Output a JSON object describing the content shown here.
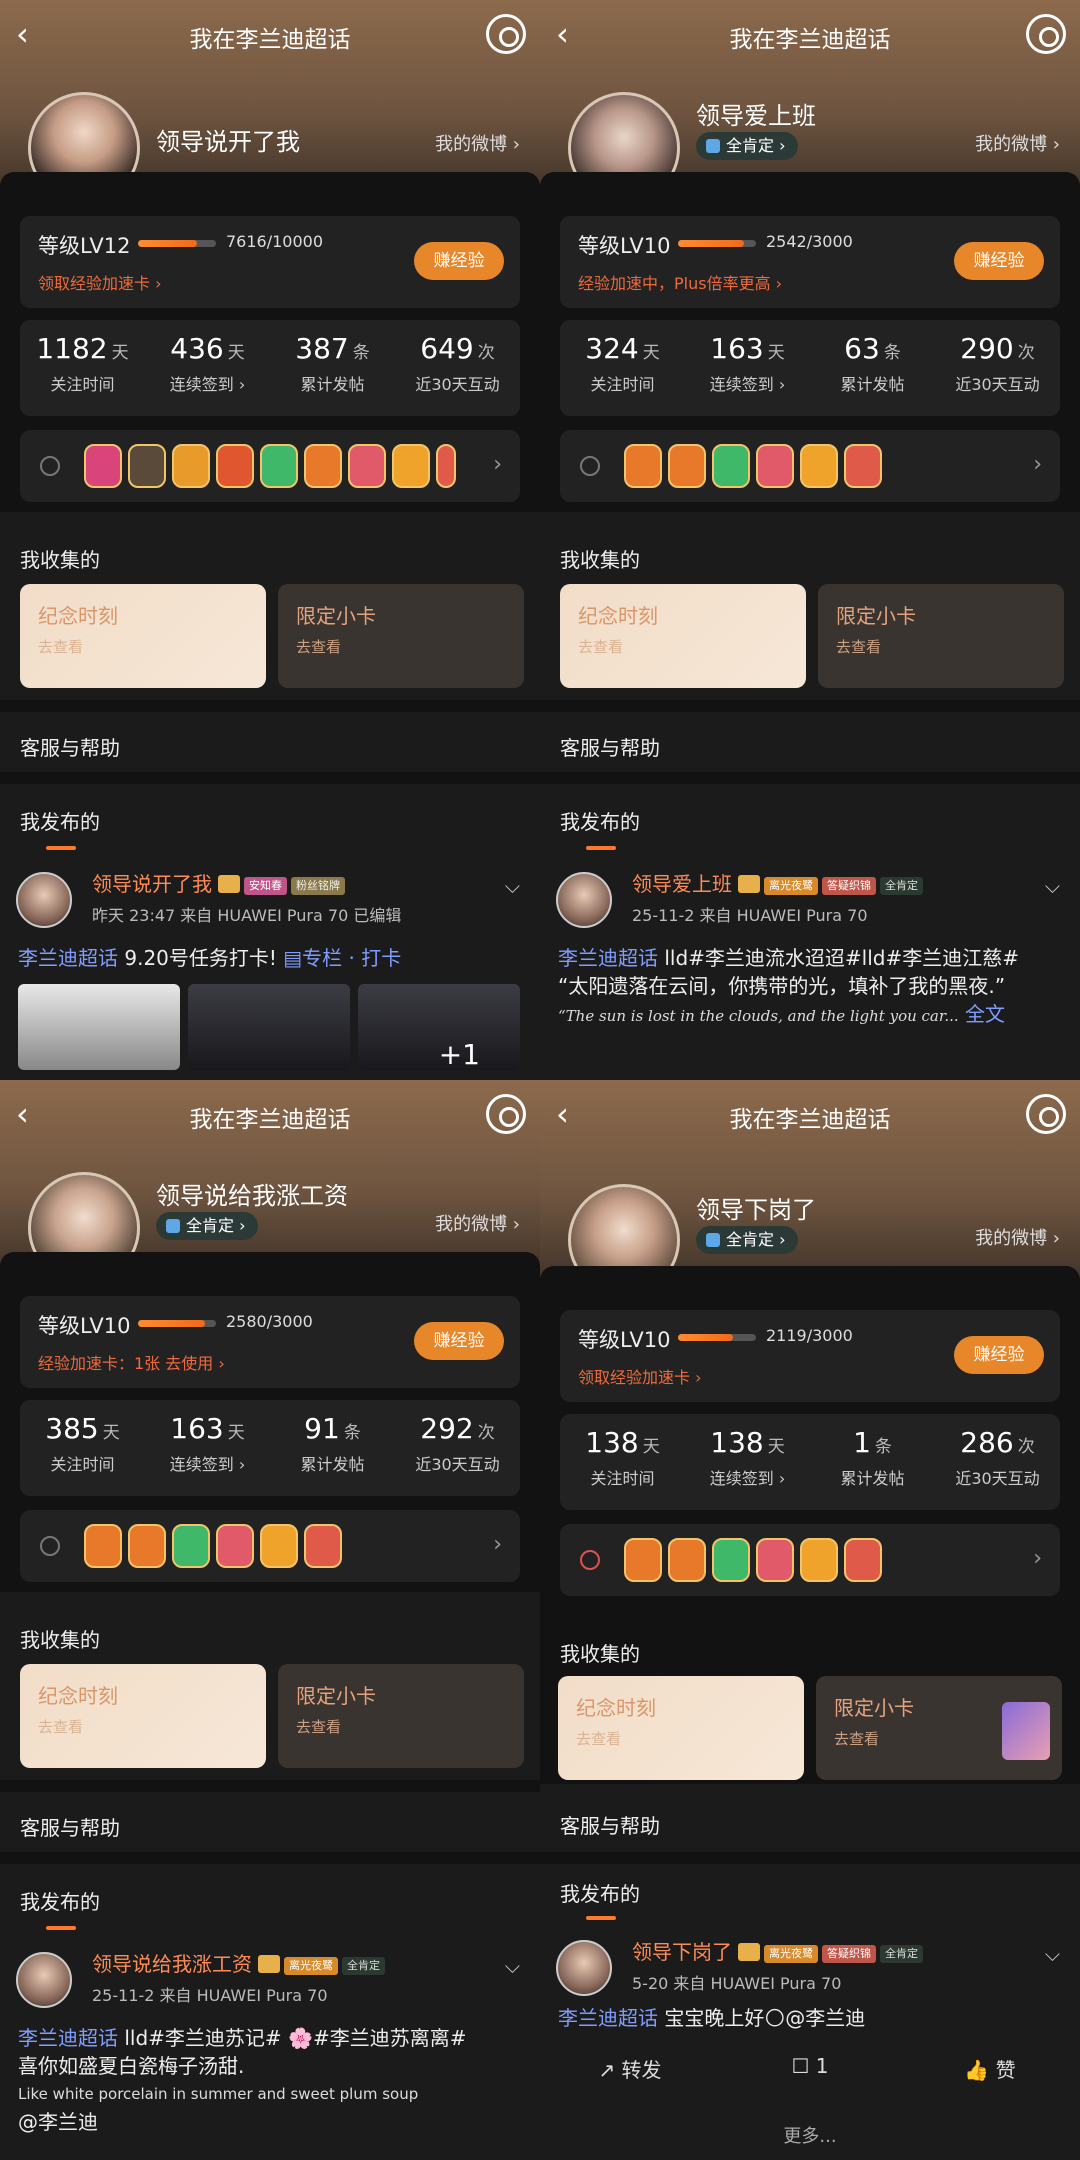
{
  "common": {
    "title": "我在李兰迪超话",
    "my_weibo": "我的微博 ›",
    "earn": "赚经验",
    "collected": "我收集的",
    "tile_a": "纪念时刻",
    "tile_b": "限定小卡",
    "tile_sub": "去查看",
    "support": "客服与帮助",
    "published": "我发布的",
    "back": "‹",
    "chev": "⌵",
    "arr": "›"
  },
  "stat_labels": [
    "关注时间",
    "连续签到 ›",
    "累计发帖",
    "近30天互动"
  ],
  "panels": [
    {
      "uname": "领导说开了我",
      "badge": "",
      "level": "等级LV12",
      "level_fraction": 0.76,
      "level_num": "7616/10000",
      "level_sub": "领取经验加速卡 ›",
      "stats": [
        {
          "v": "1182",
          "u": "天"
        },
        {
          "v": "436",
          "u": "天"
        },
        {
          "v": "387",
          "u": "条"
        },
        {
          "v": "649",
          "u": "次"
        }
      ],
      "post": {
        "name": "领导说开了我",
        "tags": [
          "安知春",
          "粉丝铭牌"
        ],
        "meta": "昨天 23:47  来自 HUAWEI Pura 70  已编辑",
        "line1_a": "李兰迪超话",
        "line1_b": " 9.20号任务打卡!  ",
        "line1_c": "▤专栏 · 打卡",
        "plus": "+1"
      }
    },
    {
      "uname": "领导爱上班",
      "badge": "全肯定 ›",
      "level": "等级LV10",
      "level_fraction": 0.85,
      "level_num": "2542/3000",
      "level_sub": "经验加速中，Plus倍率更高 ›",
      "stats": [
        {
          "v": "324",
          "u": "天"
        },
        {
          "v": "163",
          "u": "天"
        },
        {
          "v": "63",
          "u": "条"
        },
        {
          "v": "290",
          "u": "次"
        }
      ],
      "post": {
        "name": "领导爱上班",
        "tags": [
          "离光夜鹭",
          "答疑织锦",
          "全肯定"
        ],
        "meta": "25-11-2  来自 HUAWEI Pura 70",
        "line1_a": "李兰迪超话",
        "line1_b": " lld#李兰迪流水迢迢#lld#李兰迪江慈#",
        "line2": "“太阳遗落在云间，你携带的光，填补了我的黑夜.”",
        "line3": "“The sun is lost in the clouds, and the light you car...",
        "line3_more": " 全文"
      }
    },
    {
      "uname": "领导说给我涨工资",
      "badge": "全肯定 ›",
      "level": "等级LV10",
      "level_fraction": 0.86,
      "level_num": "2580/3000",
      "level_sub": "经验加速卡：1张 去使用 ›",
      "stats": [
        {
          "v": "385",
          "u": "天"
        },
        {
          "v": "163",
          "u": "天"
        },
        {
          "v": "91",
          "u": "条"
        },
        {
          "v": "292",
          "u": "次"
        }
      ],
      "post": {
        "name": "领导说给我涨工资",
        "tags": [
          "离光夜鹭",
          "全肯定"
        ],
        "meta": "25-11-2  来自 HUAWEI Pura 70",
        "line1_a": "李兰迪超话",
        "line1_b": " lld#李兰迪苏记# 🌸#李兰迪苏离离#",
        "line2": "喜你如盛夏白瓷梅子汤甜.",
        "line3": "Like white porcelain in summer and sweet plum soup",
        "line4": "@李兰迪"
      }
    },
    {
      "uname": "领导下岗了",
      "badge": "全肯定 ›",
      "level": "等级LV10",
      "level_fraction": 0.71,
      "level_num": "2119/3000",
      "level_sub": "领取经验加速卡 ›",
      "stats": [
        {
          "v": "138",
          "u": "天"
        },
        {
          "v": "138",
          "u": "天"
        },
        {
          "v": "1",
          "u": "条"
        },
        {
          "v": "286",
          "u": "次"
        }
      ],
      "post": {
        "name": "领导下岗了",
        "tags": [
          "离光夜鹭",
          "答疑织锦",
          "全肯定"
        ],
        "meta": "5-20  来自 HUAWEI Pura 70",
        "line1_a": "李兰迪超话",
        "line1_b": "  宝宝晚上好🌕@李兰迪",
        "share": "↗ 转发",
        "comment": "☐ 1",
        "like": "👍 赞",
        "more": "更多..."
      }
    }
  ],
  "colors": {
    "accent": "#e8862a",
    "link": "#7f9dff",
    "name": "#ff8c55",
    "warn": "#ee6a3d"
  }
}
